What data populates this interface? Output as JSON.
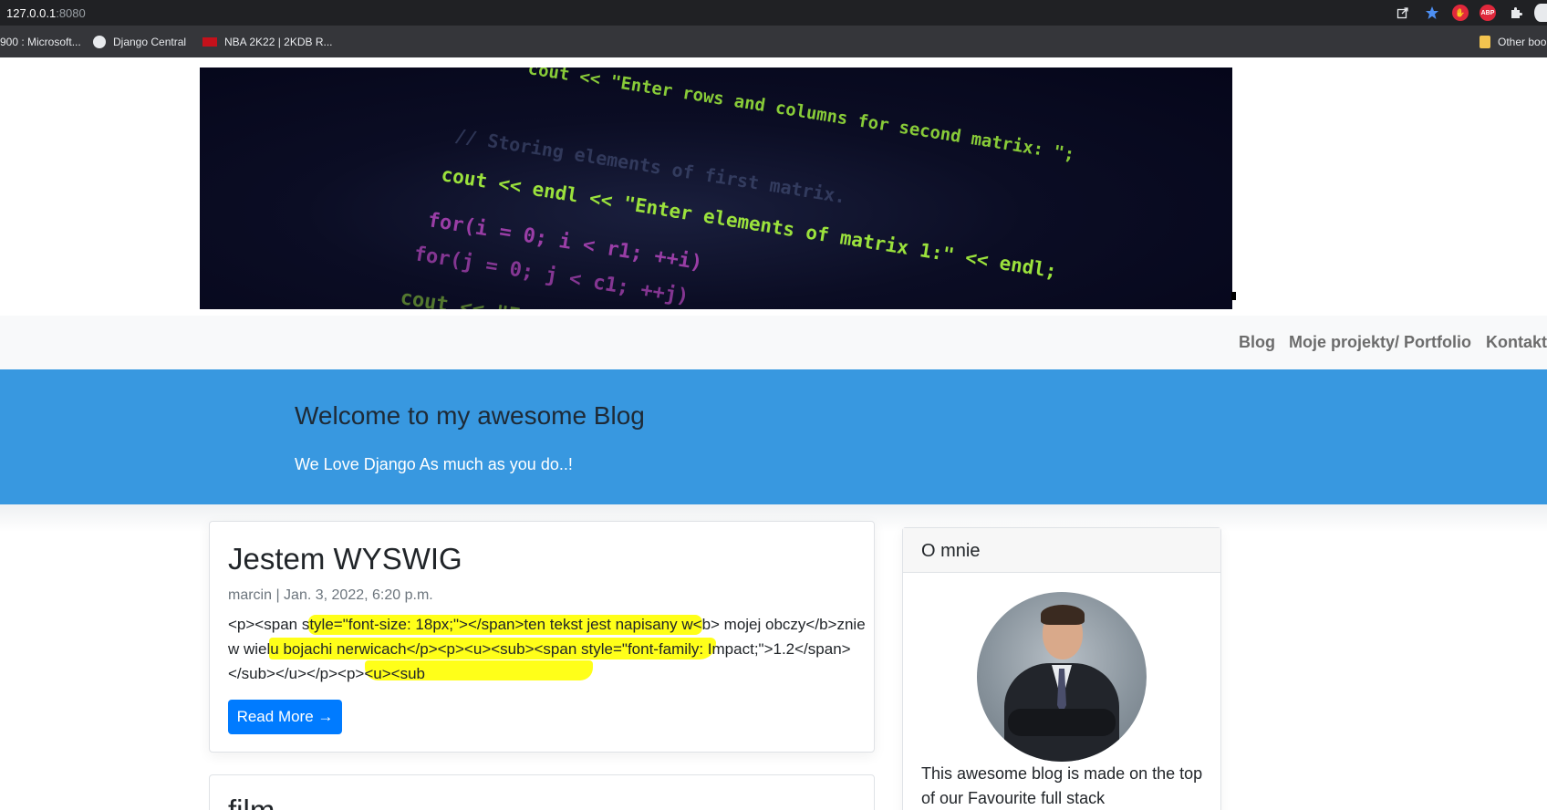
{
  "browser": {
    "url_host": "127.0.0.1",
    "url_port": ":8080",
    "bookmarks": [
      {
        "label": "900 : Microsoft..."
      },
      {
        "label": "Django Central"
      },
      {
        "label": "NBA 2K22 | 2KDB R..."
      }
    ],
    "other_bookmarks": "Other boo",
    "extension_abp": "ABP"
  },
  "header_image": {
    "code_lines": [
      "cout << \"Enter rows and columns for second matrix: \";",
      "// Storing elements of first matrix.",
      "cout << endl << \"Enter elements of matrix 1:\" << endl;",
      "for(i = 0; i < r1; ++i)",
      "for(j = 0; j < c1; ++j)",
      "cout << \"Ent"
    ]
  },
  "nav": {
    "blog": "Blog",
    "projects": "Moje projekty/ Portfolio",
    "contact": "Kontakt"
  },
  "jumbotron": {
    "title": "Welcome to my awesome Blog",
    "subtitle": "We Love Django As much as you do..!"
  },
  "posts": [
    {
      "title": "Jestem WYSWIG",
      "meta": "marcin | Jan. 3, 2022, 6:20 p.m.",
      "excerpt": "<p><span style=\"font-size: 18px;\"></span>ten tekst jest napisany w<b> mojej obczy</b>znie w wielu bojachi nerwicach</p><p><u><sub><span style=\"font-family: Impact;\">1.2</span></sub></u></p><p><u><sub",
      "read_more": "Read More →"
    },
    {
      "title": "film"
    }
  ],
  "sidebar": {
    "title": "O mnie",
    "text": "This awesome blog is made on the top of our Favourite full stack"
  }
}
